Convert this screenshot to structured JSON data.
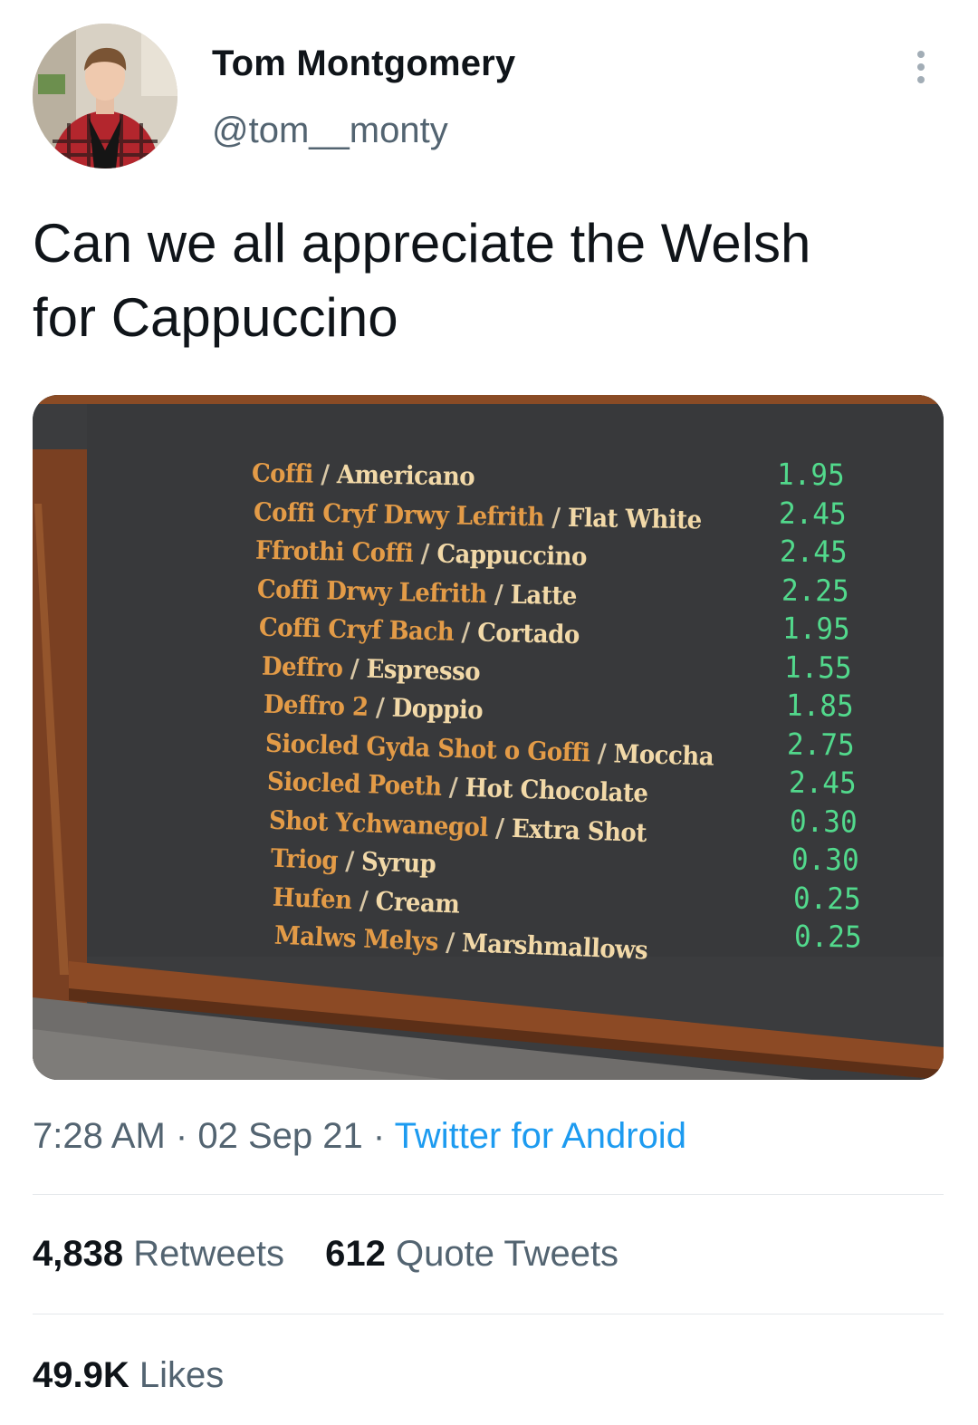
{
  "author": {
    "name": "Tom Montgomery",
    "handle": "@tom__monty"
  },
  "tweet": {
    "text_line1": "Can we all appreciate the Welsh",
    "text_line2": "for Cappuccino"
  },
  "menu_board": {
    "items": [
      {
        "welsh": "Coffi",
        "english": "Americano",
        "price": "1.95"
      },
      {
        "welsh": "Coffi Cryf Drwy Lefrith",
        "english": "Flat White",
        "price": "2.45"
      },
      {
        "welsh": "Ffrothi Coffi",
        "english": "Cappuccino",
        "price": "2.45"
      },
      {
        "welsh": "Coffi Drwy Lefrith",
        "english": "Latte",
        "price": "2.25"
      },
      {
        "welsh": "Coffi Cryf Bach",
        "english": "Cortado",
        "price": "1.95"
      },
      {
        "welsh": "Deffro",
        "english": "Espresso",
        "price": "1.55"
      },
      {
        "welsh": "Deffro 2",
        "english": "Doppio",
        "price": "1.85"
      },
      {
        "welsh": "Siocled Gyda Shot o Goffi",
        "english": "Moccha",
        "price": "2.75"
      },
      {
        "welsh": "Siocled Poeth",
        "english": "Hot Chocolate",
        "price": "2.45"
      },
      {
        "welsh": "Shot Ychwanegol",
        "english": "Extra Shot",
        "price": "0.30"
      },
      {
        "welsh": "Triog",
        "english": "Syrup",
        "price": "0.30"
      },
      {
        "welsh": "Hufen",
        "english": "Cream",
        "price": "0.25"
      },
      {
        "welsh": "Malws Melys",
        "english": "Marshmallows",
        "price": "0.25"
      }
    ],
    "separator": "/"
  },
  "meta": {
    "time": "7:28 AM",
    "dot": "·",
    "date": "02 Sep 21",
    "source": "Twitter for Android"
  },
  "stats": {
    "retweets_count": "4,838",
    "retweets_label": "Retweets",
    "quotes_count": "612",
    "quotes_label": "Quote Tweets",
    "likes_count": "49.9K",
    "likes_label": "Likes"
  },
  "colors": {
    "link": "#1d9bf0",
    "secondary_text": "#536471",
    "welsh_text": "#e39b47",
    "english_text": "#f2d9a8",
    "price_text": "#52d98c"
  }
}
